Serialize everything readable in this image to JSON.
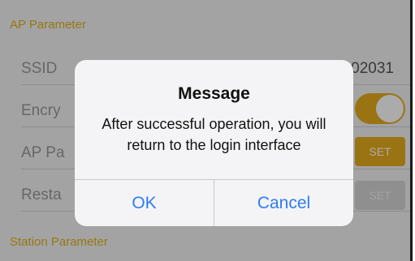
{
  "sections": {
    "ap_parameter": "AP Parameter",
    "station_parameter": "Station Parameter"
  },
  "rows": {
    "ssid_label": "SSID",
    "ssid_value": "02031",
    "encryption_label": "Encry",
    "encryption_enabled": true,
    "ap_password_label": "AP Pa",
    "ap_password_button": "SET",
    "restart_label": "Resta",
    "restart_button": "SET"
  },
  "dialog": {
    "title": "Message",
    "message": "After successful operation, you will return to the login interface",
    "ok_label": "OK",
    "cancel_label": "Cancel"
  },
  "colors": {
    "accent": "#e6ac1c",
    "dialog_button": "#2f7cf6"
  }
}
